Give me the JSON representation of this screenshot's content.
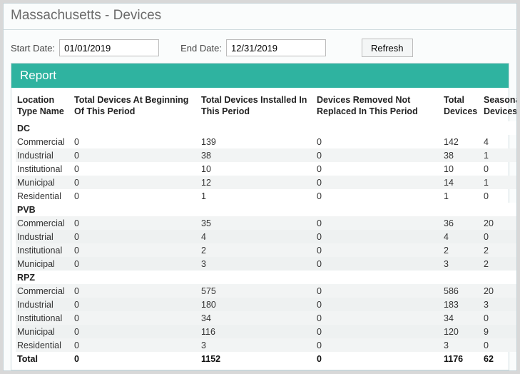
{
  "title": "Massachusetts - Devices",
  "controls": {
    "start_label": "Start Date:",
    "start_value": "01/01/2019",
    "end_label": "End Date:",
    "end_value": "12/31/2019",
    "refresh_label": "Refresh"
  },
  "report": {
    "header": "Report",
    "columns": [
      "Location Type Name",
      "Total Devices At Beginning Of This Period",
      "Total Devices Installed In This Period",
      "Devices Removed Not Replaced In This Period",
      "Total Devices",
      "Seasonal Devices"
    ],
    "groups": [
      {
        "name": "DC",
        "rows": [
          {
            "label": "Commercial",
            "v": [
              "0",
              "139",
              "0",
              "142",
              "4"
            ]
          },
          {
            "label": "Industrial",
            "v": [
              "0",
              "38",
              "0",
              "38",
              "1"
            ]
          },
          {
            "label": "Institutional",
            "v": [
              "0",
              "10",
              "0",
              "10",
              "0"
            ]
          },
          {
            "label": "Municipal",
            "v": [
              "0",
              "12",
              "0",
              "14",
              "1"
            ]
          },
          {
            "label": "Residential",
            "v": [
              "0",
              "1",
              "0",
              "1",
              "0"
            ]
          }
        ]
      },
      {
        "name": "PVB",
        "rows": [
          {
            "label": "Commercial",
            "v": [
              "0",
              "35",
              "0",
              "36",
              "20"
            ]
          },
          {
            "label": "Industrial",
            "v": [
              "0",
              "4",
              "0",
              "4",
              "0"
            ]
          },
          {
            "label": "Institutional",
            "v": [
              "0",
              "2",
              "0",
              "2",
              "2"
            ]
          },
          {
            "label": "Municipal",
            "v": [
              "0",
              "3",
              "0",
              "3",
              "2"
            ]
          }
        ]
      },
      {
        "name": "RPZ",
        "rows": [
          {
            "label": "Commercial",
            "v": [
              "0",
              "575",
              "0",
              "586",
              "20"
            ]
          },
          {
            "label": "Industrial",
            "v": [
              "0",
              "180",
              "0",
              "183",
              "3"
            ]
          },
          {
            "label": "Institutional",
            "v": [
              "0",
              "34",
              "0",
              "34",
              "0"
            ]
          },
          {
            "label": "Municipal",
            "v": [
              "0",
              "116",
              "0",
              "120",
              "9"
            ]
          },
          {
            "label": "Residential",
            "v": [
              "0",
              "3",
              "0",
              "3",
              "0"
            ]
          }
        ]
      }
    ],
    "total": {
      "label": "Total",
      "v": [
        "0",
        "1152",
        "0",
        "1176",
        "62"
      ]
    }
  }
}
